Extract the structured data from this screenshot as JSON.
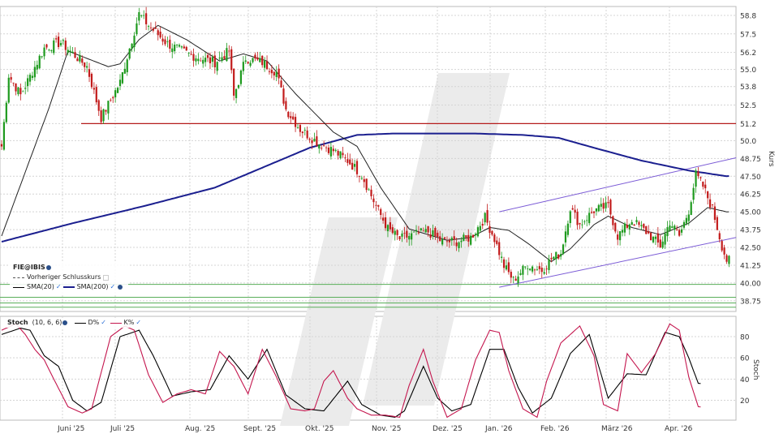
{
  "chart_data": [
    {
      "type": "candlestick",
      "symbol_label": "FIE@IBIS",
      "legend": {
        "prev_close_label": "Vorheriger Schlusskurs",
        "sma20_label": "SMA(20)",
        "sma200_label": "SMA(200)"
      },
      "ylabel": "Kurs",
      "ylim": [
        38.0,
        59.8
      ],
      "y_ticks": [
        "58.8",
        "57.5",
        "56.2",
        "55.0",
        "53.8",
        "52.5",
        "51.2",
        "50.0",
        "48.75",
        "47.50",
        "46.25",
        "45.00",
        "43.75",
        "42.50",
        "41.25",
        "40.00",
        "38.75"
      ],
      "x_ticks": [
        "Juni '25",
        "Juli '25",
        "Aug. '25",
        "Sept. '25",
        "Okt. '25",
        "Nov. '25",
        "Dez. '25",
        "Jan. '26",
        "Feb. '26",
        "März '26",
        "Apr. '26"
      ],
      "start_price": 49.6,
      "anchors": [
        [
          0,
          49.6
        ],
        [
          3,
          54.6
        ],
        [
          8,
          53.2
        ],
        [
          18,
          56.5
        ],
        [
          25,
          56.9
        ],
        [
          36,
          55.2
        ],
        [
          42,
          51.6
        ],
        [
          50,
          54.1
        ],
        [
          58,
          58.9
        ],
        [
          62,
          58.1
        ],
        [
          70,
          56.8
        ],
        [
          80,
          56.0
        ],
        [
          90,
          55.5
        ],
        [
          96,
          56.3
        ],
        [
          98,
          53.1
        ],
        [
          103,
          55.8
        ],
        [
          110,
          55.5
        ],
        [
          116,
          54.8
        ],
        [
          120,
          52.2
        ],
        [
          126,
          50.8
        ],
        [
          134,
          49.8
        ],
        [
          140,
          49.3
        ],
        [
          146,
          48.6
        ],
        [
          152,
          47.6
        ],
        [
          158,
          45.4
        ],
        [
          163,
          43.8
        ],
        [
          168,
          43.1
        ],
        [
          174,
          43.4
        ],
        [
          180,
          43.6
        ],
        [
          186,
          42.9
        ],
        [
          192,
          42.9
        ],
        [
          198,
          43.2
        ],
        [
          204,
          44.6
        ],
        [
          208,
          43.1
        ],
        [
          212,
          41.2
        ],
        [
          216,
          40.2
        ],
        [
          222,
          41.3
        ],
        [
          228,
          40.9
        ],
        [
          232,
          41.7
        ],
        [
          236,
          42.1
        ],
        [
          240,
          45.3
        ],
        [
          244,
          44.1
        ],
        [
          250,
          45.1
        ],
        [
          256,
          45.4
        ],
        [
          260,
          43.3
        ],
        [
          266,
          44.4
        ],
        [
          272,
          43.6
        ],
        [
          278,
          42.6
        ],
        [
          282,
          44.3
        ],
        [
          286,
          43.3
        ],
        [
          290,
          45.1
        ],
        [
          293,
          47.6
        ],
        [
          296,
          46.8
        ],
        [
          300,
          45.2
        ],
        [
          304,
          42.6
        ],
        [
          306,
          41.6
        ]
      ],
      "sma20_anchors": [
        [
          0,
          43.3
        ],
        [
          20,
          52.3
        ],
        [
          28,
          56.3
        ],
        [
          45,
          55.2
        ],
        [
          50,
          55.4
        ],
        [
          58,
          57.1
        ],
        [
          66,
          58.1
        ],
        [
          78,
          57.1
        ],
        [
          92,
          55.6
        ],
        [
          102,
          56.1
        ],
        [
          112,
          55.6
        ],
        [
          124,
          53.3
        ],
        [
          140,
          50.6
        ],
        [
          150,
          49.6
        ],
        [
          160,
          46.7
        ],
        [
          172,
          43.8
        ],
        [
          188,
          43.0
        ],
        [
          198,
          43.2
        ],
        [
          206,
          43.9
        ],
        [
          214,
          43.7
        ],
        [
          222,
          42.8
        ],
        [
          232,
          41.5
        ],
        [
          240,
          42.4
        ],
        [
          250,
          44.1
        ],
        [
          256,
          44.7
        ],
        [
          266,
          43.9
        ],
        [
          278,
          43.4
        ],
        [
          290,
          44.2
        ],
        [
          298,
          45.3
        ],
        [
          306,
          45.0
        ]
      ],
      "sma200_anchors": [
        [
          0,
          42.9
        ],
        [
          30,
          44.2
        ],
        [
          60,
          45.4
        ],
        [
          90,
          46.7
        ],
        [
          110,
          48.1
        ],
        [
          130,
          49.5
        ],
        [
          150,
          50.4
        ],
        [
          165,
          50.5
        ],
        [
          200,
          50.5
        ],
        [
          220,
          50.4
        ],
        [
          235,
          50.2
        ],
        [
          250,
          49.5
        ],
        [
          270,
          48.6
        ],
        [
          290,
          47.9
        ],
        [
          306,
          47.5
        ]
      ],
      "hline_red": 51.2,
      "hlines_green": [
        39.9,
        39.0,
        38.6,
        38.3
      ],
      "channel": {
        "upper": [
          [
            210,
            45.0
          ],
          [
            310,
            48.8
          ]
        ],
        "lower": [
          [
            210,
            39.7
          ],
          [
            310,
            43.2
          ]
        ]
      }
    },
    {
      "type": "line",
      "indicator_label": "Stoch",
      "params": "(10, 6, 6)",
      "series": [
        {
          "name": "D%",
          "color": "#000000",
          "anchors": [
            [
              0,
              82
            ],
            [
              8,
              88
            ],
            [
              12,
              86
            ],
            [
              18,
              62
            ],
            [
              24,
              52
            ],
            [
              30,
              20
            ],
            [
              36,
              10
            ],
            [
              42,
              18
            ],
            [
              50,
              80
            ],
            [
              58,
              86
            ],
            [
              64,
              62
            ],
            [
              72,
              24
            ],
            [
              80,
              28
            ],
            [
              88,
              30
            ],
            [
              96,
              62
            ],
            [
              104,
              40
            ],
            [
              112,
              68
            ],
            [
              120,
              25
            ],
            [
              128,
              12
            ],
            [
              136,
              10
            ],
            [
              146,
              38
            ],
            [
              152,
              16
            ],
            [
              160,
              6
            ],
            [
              166,
              4
            ],
            [
              170,
              10
            ],
            [
              178,
              52
            ],
            [
              184,
              22
            ],
            [
              190,
              10
            ],
            [
              198,
              16
            ],
            [
              206,
              68
            ],
            [
              212,
              68
            ],
            [
              218,
              32
            ],
            [
              224,
              8
            ],
            [
              232,
              22
            ],
            [
              240,
              64
            ],
            [
              248,
              82
            ],
            [
              256,
              22
            ],
            [
              264,
              45
            ],
            [
              272,
              44
            ],
            [
              280,
              84
            ],
            [
              286,
              80
            ],
            [
              290,
              60
            ],
            [
              294,
              36
            ]
          ]
        },
        {
          "name": "K%",
          "color": "#c4164e",
          "anchors": [
            [
              0,
              86
            ],
            [
              6,
              92
            ],
            [
              10,
              82
            ],
            [
              14,
              68
            ],
            [
              18,
              58
            ],
            [
              22,
              40
            ],
            [
              28,
              14
            ],
            [
              34,
              8
            ],
            [
              38,
              12
            ],
            [
              46,
              80
            ],
            [
              52,
              90
            ],
            [
              56,
              86
            ],
            [
              62,
              44
            ],
            [
              68,
              18
            ],
            [
              74,
              26
            ],
            [
              80,
              30
            ],
            [
              86,
              26
            ],
            [
              92,
              66
            ],
            [
              98,
              52
            ],
            [
              104,
              26
            ],
            [
              110,
              68
            ],
            [
              116,
              42
            ],
            [
              122,
              12
            ],
            [
              128,
              10
            ],
            [
              132,
              12
            ],
            [
              136,
              38
            ],
            [
              140,
              48
            ],
            [
              146,
              22
            ],
            [
              150,
              12
            ],
            [
              156,
              6
            ],
            [
              162,
              6
            ],
            [
              168,
              4
            ],
            [
              172,
              34
            ],
            [
              178,
              68
            ],
            [
              182,
              38
            ],
            [
              188,
              4
            ],
            [
              194,
              12
            ],
            [
              200,
              58
            ],
            [
              206,
              86
            ],
            [
              210,
              84
            ],
            [
              214,
              48
            ],
            [
              220,
              12
            ],
            [
              226,
              4
            ],
            [
              230,
              38
            ],
            [
              236,
              74
            ],
            [
              244,
              90
            ],
            [
              250,
              62
            ],
            [
              254,
              16
            ],
            [
              260,
              10
            ],
            [
              264,
              64
            ],
            [
              270,
              46
            ],
            [
              276,
              64
            ],
            [
              282,
              92
            ],
            [
              286,
              86
            ],
            [
              290,
              42
            ],
            [
              294,
              14
            ]
          ]
        }
      ],
      "ylabel": "Stoch",
      "y_ticks": [
        "80",
        "60",
        "40",
        "20"
      ],
      "ylim": [
        0,
        100
      ]
    }
  ]
}
